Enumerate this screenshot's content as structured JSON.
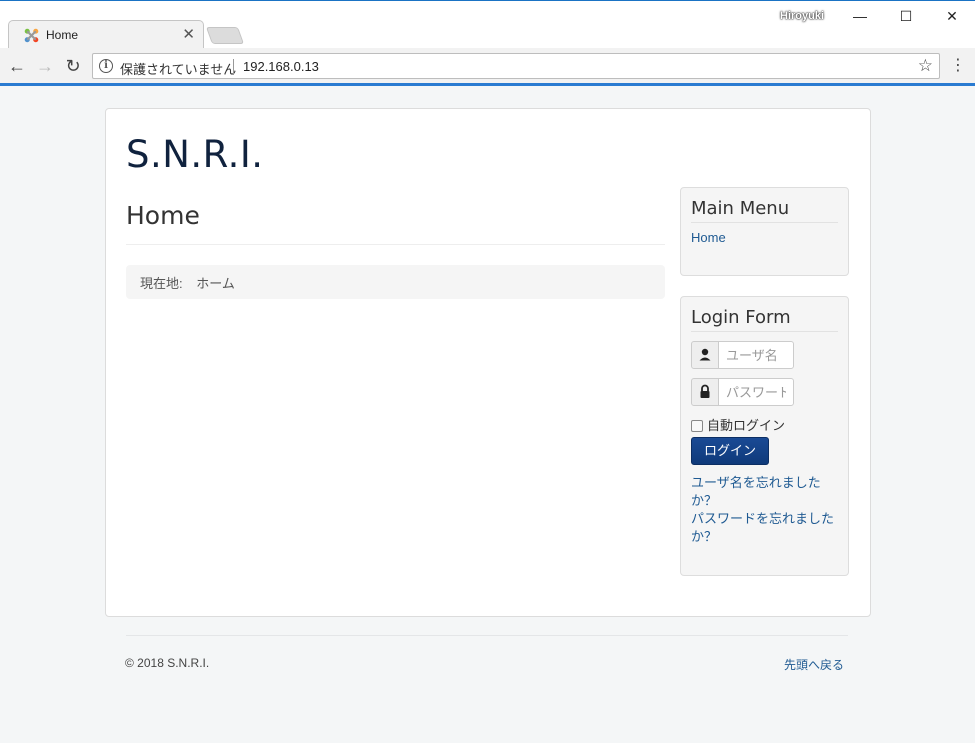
{
  "browser": {
    "tab_title": "Home",
    "tab_close": "✕",
    "profile_name": "Hiroyuki",
    "window_minimize": "—",
    "window_maximize": "☐",
    "window_close": "✕",
    "back": "←",
    "forward": "→",
    "reload": "↻",
    "security_info": "i",
    "security_label": "保護されていません",
    "url": "192.168.0.13",
    "bookmark_star": "☆",
    "menu": "⋮",
    "accent_color": "#2a7bd1"
  },
  "site": {
    "title": "S.N.R.I."
  },
  "main": {
    "heading": "Home",
    "breadcrumb_label": "現在地:",
    "breadcrumb_current": "ホーム"
  },
  "main_menu": {
    "title": "Main Menu",
    "items": [
      {
        "label": "Home"
      }
    ]
  },
  "login_form": {
    "title": "Login Form",
    "username_placeholder": "ユーザ名",
    "password_placeholder": "パスワード",
    "remember_label": "自動ログイン",
    "remember_checked": false,
    "submit_label": "ログイン",
    "forgot_username_line1": "ユーザ名を忘れました",
    "forgot_username_line2": "か？",
    "forgot_password_line1": "パスワードを忘れました",
    "forgot_password_line2": "か？",
    "button_color": "#134388"
  },
  "footer": {
    "copyright": "© 2018 S.N.R.I.",
    "back_to_top": "先頭へ戻る"
  }
}
